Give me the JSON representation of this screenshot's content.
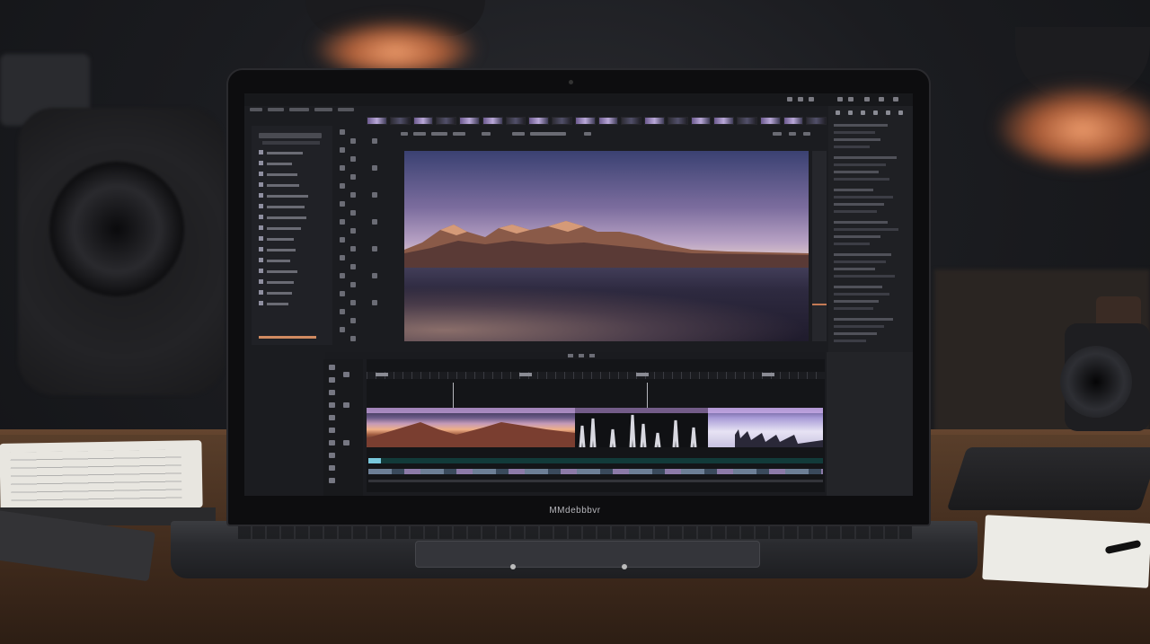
{
  "screen": {
    "app_title": "",
    "left_panel": {
      "items": [
        {
          "label": ""
        },
        {
          "label": ""
        },
        {
          "label": ""
        },
        {
          "label": ""
        },
        {
          "label": ""
        },
        {
          "label": ""
        },
        {
          "label": ""
        },
        {
          "label": ""
        },
        {
          "label": ""
        },
        {
          "label": ""
        },
        {
          "label": ""
        },
        {
          "label": ""
        },
        {
          "label": ""
        },
        {
          "label": ""
        },
        {
          "label": ""
        }
      ]
    },
    "viewer": {
      "scene": "sunset-coast-rocks"
    },
    "timeline": {
      "clips": [
        "clip-sunset-rocks",
        "clip-dark-waveform",
        "clip-bright-sky"
      ]
    }
  },
  "laptop": {
    "brand": "MMdebbbvr"
  },
  "colors": {
    "accent_orange": "#d08a60",
    "clip_highlight_purple": "#c9a4e0",
    "audio_teal": "#123b3a"
  }
}
